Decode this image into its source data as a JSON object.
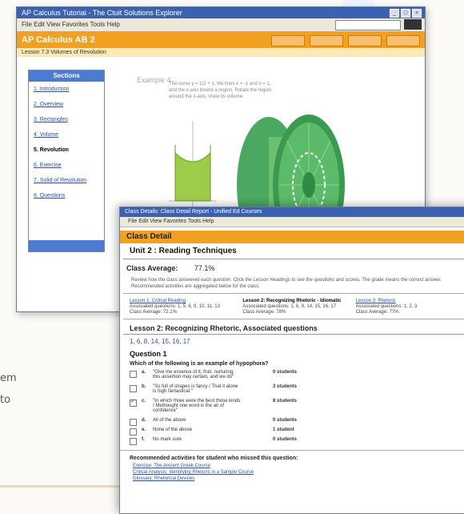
{
  "background": {
    "text_line1": "em",
    "text_line2": "to"
  },
  "window1": {
    "title": "AP Calculus Tutorial - The Ctuit Solutions Explorer",
    "menu": "File  Edit  View  Favorites  Tools  Help",
    "app_title": "AP Calculus AB 2",
    "breadcrumb": "Lesson 7.3 Volumes of Revolution",
    "sidebar": {
      "header": "Sections",
      "items": [
        {
          "label": "1. Introduction",
          "current": false
        },
        {
          "label": "2. Overview",
          "current": false
        },
        {
          "label": "3. Rectangles",
          "current": false
        },
        {
          "label": "4. Volume",
          "current": false
        },
        {
          "label": "5. Revolution",
          "current": true
        },
        {
          "label": "6. Exercise",
          "current": false
        },
        {
          "label": "7. Solid of Revolution",
          "current": false
        },
        {
          "label": "8. Questions",
          "current": false
        }
      ]
    },
    "example_heading": "Example 4",
    "example_text": "The curve y = 1/2 + 1, the lines x = -1 and x = 1, and the x-axis bound a region. Rotate the region around the x-axis; show its volume."
  },
  "window2": {
    "title": "Class Details: Class Detail Report - Unified Ed Courses",
    "menu": "File   Edit   View   Favorites   Tools   Help",
    "class_detail": "Class Detail",
    "unit": "Unit 2 : Reading Techniques",
    "avg_label": "Class Average:",
    "avg_value": "77.1%",
    "intro": "Review how the class answered each question. Click the Lesson Headings to see the questions and scores. The grade means the correct answer. Recommended activities are aggregated below for the class.",
    "lessons": [
      {
        "title": "Lesson 1: Critical Reading",
        "detail": "Associated questions: 1, 5, 6, 9, 10, 11, 13",
        "avg": "Class Average: 72.1%",
        "bold": false
      },
      {
        "title": "Lesson 2: Recognizing Rhetoric - Idiomatic",
        "detail": "Associated questions: 1, 6, 8, 14, 15, 16, 17",
        "avg": "Class Average: 78%",
        "bold": true
      },
      {
        "title": "Lesson 3: Rhetoric",
        "detail": "Associated questions: 1, 2, 3",
        "avg": "Class Average: 77%",
        "bold": false
      }
    ],
    "section_title": "Lesson 2: Recognizing Rhetoric, Associated questions",
    "question_links": "1, 6, 8, 14, 15, 16, 17",
    "question_title": "Question 1",
    "question_text": "Which of the following is an example of hypophora?",
    "options": [
      {
        "letter": "a.",
        "text": "\"Give me essence of it, fruit, nurturing, this assertion may certain, and we do\"",
        "students": "0 students",
        "checked": false
      },
      {
        "letter": "b.",
        "text": "\"So full of shapes is fancy / That it alone is high fantastical.\"",
        "students": "3 students",
        "checked": false
      },
      {
        "letter": "c.",
        "text": "\"In which three were the best those kinds / Methought one word is the air of confidence\"",
        "students": "8 students",
        "checked": true
      },
      {
        "letter": "d.",
        "text": "All of the above",
        "students": "0 students",
        "checked": false
      },
      {
        "letter": "e.",
        "text": "None of the above",
        "students": "1 student",
        "checked": false
      },
      {
        "letter": "f.",
        "text": "No mark sure",
        "students": "0 students",
        "checked": false
      }
    ],
    "recommended_label": "Recommended activities for student who missed this question:",
    "recommended": [
      "Exercise: The Ancient Greek Course",
      "Critical Analysis: Identifying Rhetoric in a Sample Course",
      "Glossary: Rhetorical Devices"
    ]
  }
}
